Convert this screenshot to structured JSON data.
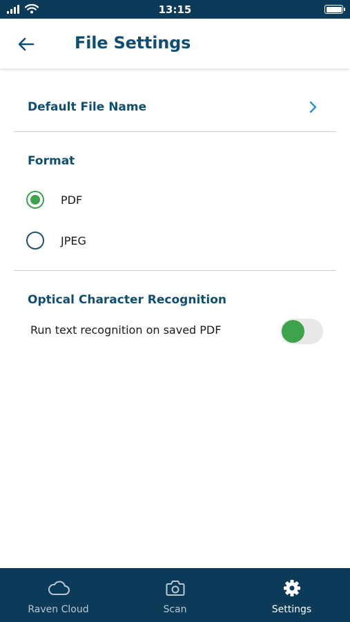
{
  "status_bar": {
    "time": "13:15"
  },
  "header": {
    "title": "File Settings",
    "back_icon": "arrow-left-icon"
  },
  "default_file_name": {
    "label": "Default File Name",
    "icon": "chevron-right-icon"
  },
  "format": {
    "title": "Format",
    "options": [
      {
        "label": "PDF",
        "selected": true
      },
      {
        "label": "JPEG",
        "selected": false
      }
    ]
  },
  "ocr": {
    "title": "Optical Character Recognition",
    "setting_label": "Run text recognition on saved PDF",
    "enabled": true
  },
  "bottom_nav": {
    "items": [
      {
        "label": "Raven Cloud",
        "icon": "cloud-icon",
        "active": false
      },
      {
        "label": "Scan",
        "icon": "camera-icon",
        "active": false
      },
      {
        "label": "Settings",
        "icon": "gear-icon",
        "active": true
      }
    ]
  },
  "colors": {
    "brand": "#0b3b58",
    "heading": "#0f4e74",
    "accent_green": "#3fa34d",
    "chevron": "#2a8fcf"
  }
}
